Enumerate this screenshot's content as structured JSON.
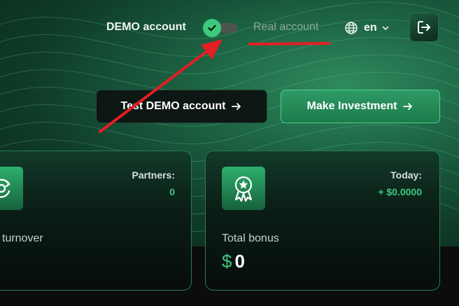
{
  "header": {
    "demo_label": "DEMO account",
    "real_label": "Real account",
    "language": "en",
    "toggle_state": "demo"
  },
  "actions": {
    "test_demo_label": "Test DEMO account",
    "make_investment_label": "Make Investment"
  },
  "cards": {
    "left": {
      "stat_label": "Partners:",
      "stat_value": "0",
      "title": "l turnover"
    },
    "right": {
      "stat_label": "Today:",
      "stat_value": "+ $0.0000",
      "title": "Total bonus",
      "currency": "$",
      "amount": "0"
    }
  },
  "colors": {
    "accent": "#3ec97c",
    "annotation": "#e31e24"
  },
  "icons": [
    "check-icon",
    "globe-icon",
    "chevron-down-icon",
    "logout-icon",
    "arrow-right-icon",
    "refresh-coin-icon",
    "award-badge-icon"
  ]
}
